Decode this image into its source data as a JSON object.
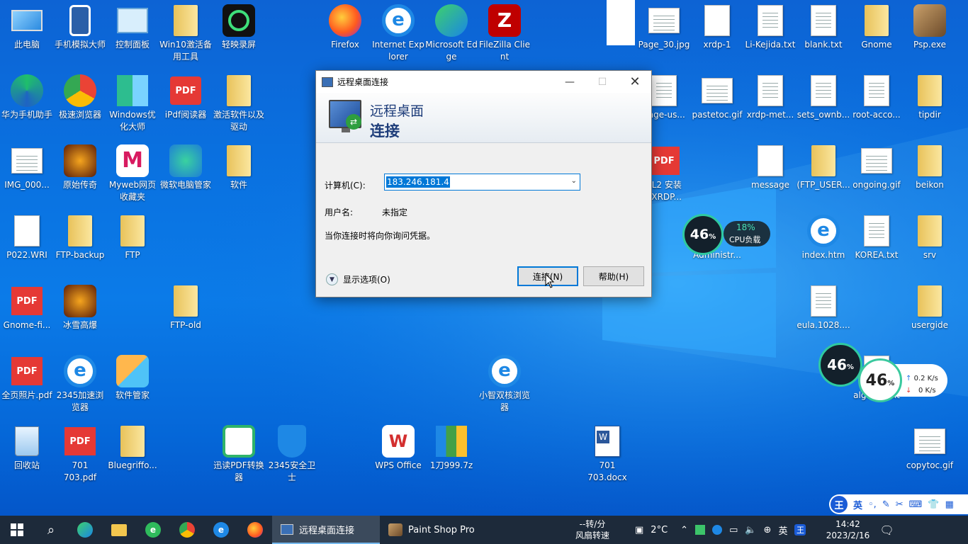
{
  "desktop": {
    "icons": [
      {
        "label": "此电脑",
        "icon": "computer-icon"
      },
      {
        "label": "手机模拟大师",
        "icon": "phone-emulator-icon"
      },
      {
        "label": "控制面板",
        "icon": "control-panel-icon"
      },
      {
        "label": "Win10激活备用工具",
        "icon": "folder-icon"
      },
      {
        "label": "轻映录屏",
        "icon": "recorder-icon"
      },
      {
        "label": "Firefox",
        "icon": "firefox-icon"
      },
      {
        "label": "Internet Explorer",
        "icon": "ie-icon"
      },
      {
        "label": "Microsoft Edge",
        "icon": "edge-icon"
      },
      {
        "label": "FileZilla Client",
        "icon": "filezilla-icon"
      },
      {
        "label": "Page_30.jpg",
        "icon": "image-file-icon"
      },
      {
        "label": "xrdp-1",
        "icon": "file-icon"
      },
      {
        "label": "Li-Kejida.txt",
        "icon": "text-file-icon"
      },
      {
        "label": "blank.txt",
        "icon": "text-file-icon"
      },
      {
        "label": "Gnome",
        "icon": "folder-icon"
      },
      {
        "label": "Psp.exe",
        "icon": "psp-icon"
      },
      {
        "label": "华为手机助手",
        "icon": "huawei-icon"
      },
      {
        "label": "极速浏览器",
        "icon": "browser-icon"
      },
      {
        "label": "Windows优化大师",
        "icon": "windows-master-icon"
      },
      {
        "label": "iPdf阅读器",
        "icon": "pdf-reader-icon"
      },
      {
        "label": "激活软件以及驱动",
        "icon": "folder-icon"
      },
      {
        "label": "ange-us...",
        "icon": "text-file-icon"
      },
      {
        "label": "pastetoc.gif",
        "icon": "image-file-icon"
      },
      {
        "label": "xrdp-met...",
        "icon": "text-file-icon"
      },
      {
        "label": "sets_ownb...",
        "icon": "text-file-icon"
      },
      {
        "label": "root-acco...",
        "icon": "text-file-icon"
      },
      {
        "label": "tipdir",
        "icon": "folder-icon"
      },
      {
        "label": "IMG_000...",
        "icon": "image-file-icon"
      },
      {
        "label": "原始传奇",
        "icon": "game-icon"
      },
      {
        "label": "Myweb网页收藏夹",
        "icon": "myweb-icon"
      },
      {
        "label": "微软电脑管家",
        "icon": "pc-manager-icon"
      },
      {
        "label": "软件",
        "icon": "folder-icon"
      },
      {
        "label": "SL2 安装\nI XRDP...",
        "icon": "pdf-file-icon"
      },
      {
        "label": "message",
        "icon": "file-icon"
      },
      {
        "label": "(FTP_USER...",
        "icon": "folder-icon"
      },
      {
        "label": "ongoing.gif",
        "icon": "image-file-icon"
      },
      {
        "label": "beikon",
        "icon": "folder-icon"
      },
      {
        "label": "P022.WRI",
        "icon": "file-icon"
      },
      {
        "label": "FTP-backup",
        "icon": "folder-icon"
      },
      {
        "label": "FTP",
        "icon": "folder-icon"
      },
      {
        "label": "Administr...",
        "icon": "user-icon"
      },
      {
        "label": "index.htm",
        "icon": "ie-icon"
      },
      {
        "label": "KOREA.txt",
        "icon": "text-file-icon"
      },
      {
        "label": "srv",
        "icon": "folder-icon"
      },
      {
        "label": "Gnome-fi...",
        "icon": "pdf-file-icon"
      },
      {
        "label": "冰雪高爆",
        "icon": "game-icon"
      },
      {
        "label": "FTP-old",
        "icon": "folder-icon"
      },
      {
        "label": "eula.1028....",
        "icon": "text-file-icon"
      },
      {
        "label": "usergide",
        "icon": "folder-icon"
      },
      {
        "label": "全页照片.pdf",
        "icon": "pdf-file-icon"
      },
      {
        "label": "2345加速浏览器",
        "icon": "ie-icon"
      },
      {
        "label": "软件管家",
        "icon": "software-manager-icon"
      },
      {
        "label": "小智双核浏览器",
        "icon": "ie-icon"
      },
      {
        "label": "algdata.txt",
        "icon": "text-file-icon"
      },
      {
        "label": "回收站",
        "icon": "recycle-bin-icon"
      },
      {
        "label": "701\n703.pdf",
        "icon": "pdf-file-icon"
      },
      {
        "label": "Bluegriffo...",
        "icon": "folder-icon"
      },
      {
        "label": "迅读PDF转换器",
        "icon": "pdf-converter-icon"
      },
      {
        "label": "2345安全卫士",
        "icon": "shield-icon"
      },
      {
        "label": "WPS Office",
        "icon": "wps-icon"
      },
      {
        "label": "1刀999.7z",
        "icon": "archive-icon"
      },
      {
        "label": "701\n703.docx",
        "icon": "word-file-icon"
      },
      {
        "label": "copytoc.gif",
        "icon": "image-file-icon"
      }
    ]
  },
  "gauge_small": {
    "percent": "46",
    "pct_sign": "%",
    "cpu_percent": "18%",
    "cpu_label": "CPU负载"
  },
  "gauge_big": {
    "percent": "46",
    "pct_sign": "%",
    "up": "0.2 K/s",
    "down": "0 K/s"
  },
  "dialog": {
    "title": "远程桌面连接",
    "header_line1": "远程桌面",
    "header_line2": "连接",
    "computer_label": "计算机(C):",
    "computer_value": "183.246.181.4",
    "user_label": "用户名:",
    "user_value": "未指定",
    "note": "当你连接时将向你询问凭据。",
    "options_label": "显示选项(O)",
    "connect_label": "连接(N)",
    "help_label": "帮助(H)"
  },
  "ime": {
    "icon": "王",
    "mode": "英"
  },
  "taskbar": {
    "apps": [
      {
        "label": "远程桌面连接"
      },
      {
        "label": "Paint Shop Pro"
      }
    ],
    "news_line1": "--转/分",
    "news_line2": "风扇转速",
    "weather": "2°C",
    "lang": "英",
    "ime_tray": "王",
    "time": "14:42",
    "date": "2023/2/16"
  }
}
